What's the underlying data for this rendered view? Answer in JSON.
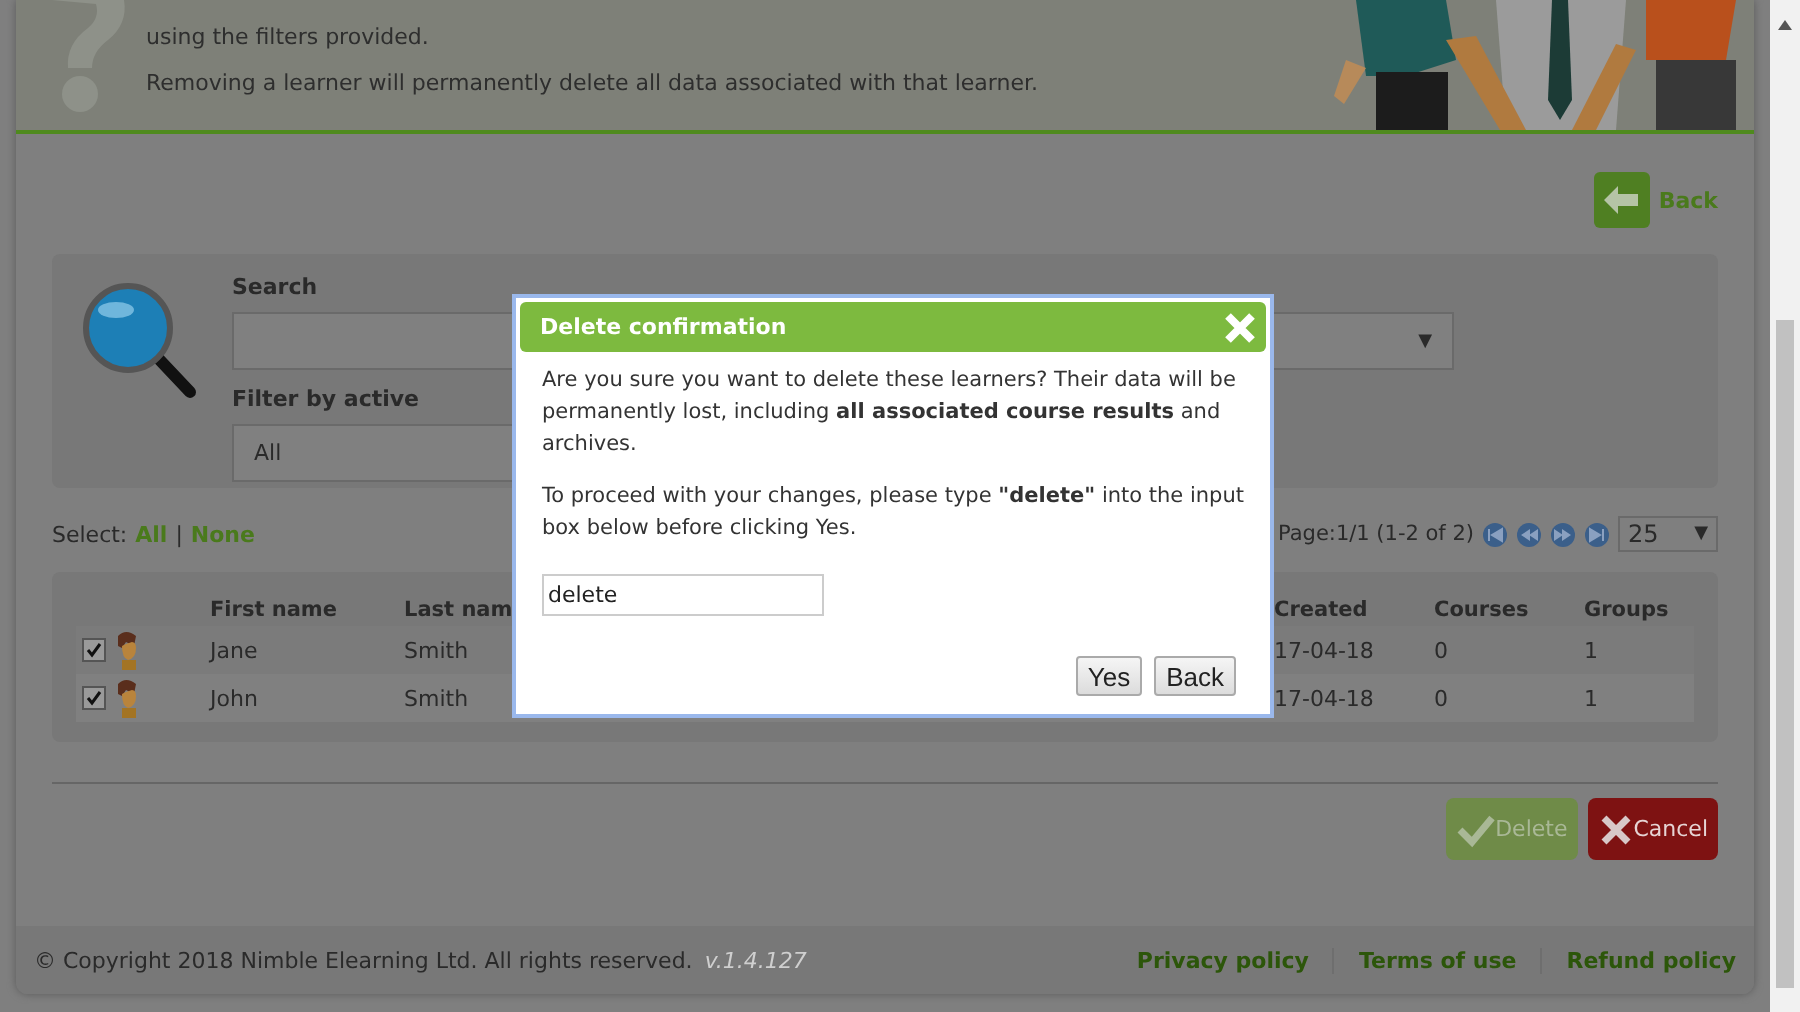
{
  "header": {
    "paragraphs": [
      "using the filters provided.",
      "Removing a learner will permanently delete all data associated with that learner."
    ]
  },
  "back_button": {
    "label": "Back"
  },
  "filters": {
    "search": {
      "label": "Search"
    },
    "active": {
      "label": "Filter by active",
      "value": "All"
    },
    "group": {
      "caret": "▼"
    }
  },
  "select": {
    "label": "Select:",
    "all": "All",
    "separator": "|",
    "none": "None"
  },
  "pagination": {
    "text": "Page:1/1 (1-2 of 2)",
    "page_size": "25",
    "caret": "▼"
  },
  "table": {
    "columns": [
      "First name",
      "Last nam",
      "Created",
      "Courses",
      "Groups"
    ],
    "rows": [
      {
        "checked": true,
        "first_name": "Jane",
        "last_name": "Smith",
        "created": "17-04-18",
        "courses": "0",
        "groups": "1"
      },
      {
        "checked": true,
        "first_name": "John",
        "last_name": "Smith",
        "created": "17-04-18",
        "courses": "0",
        "groups": "1"
      }
    ]
  },
  "actions": [
    {
      "kind": "confirm",
      "label": "Delete"
    },
    {
      "kind": "cancel",
      "label": "Cancel"
    }
  ],
  "footer": {
    "copyright": "© Copyright 2018 Nimble Elearning Ltd. All rights reserved.",
    "version": "v.1.4.127",
    "links": [
      "Privacy policy",
      "Terms of use",
      "Refund policy"
    ]
  },
  "dialog": {
    "title": "Delete confirmation",
    "paragraphs": [
      "Are you sure you want to delete these learners? Their data will be permanently lost, including **all associated course results** and archives.",
      "To proceed with your changes, please type **\"delete\"** into the input box below before clicking Yes."
    ],
    "input_value": "delete",
    "buttons": [
      "Yes",
      "Back"
    ]
  }
}
